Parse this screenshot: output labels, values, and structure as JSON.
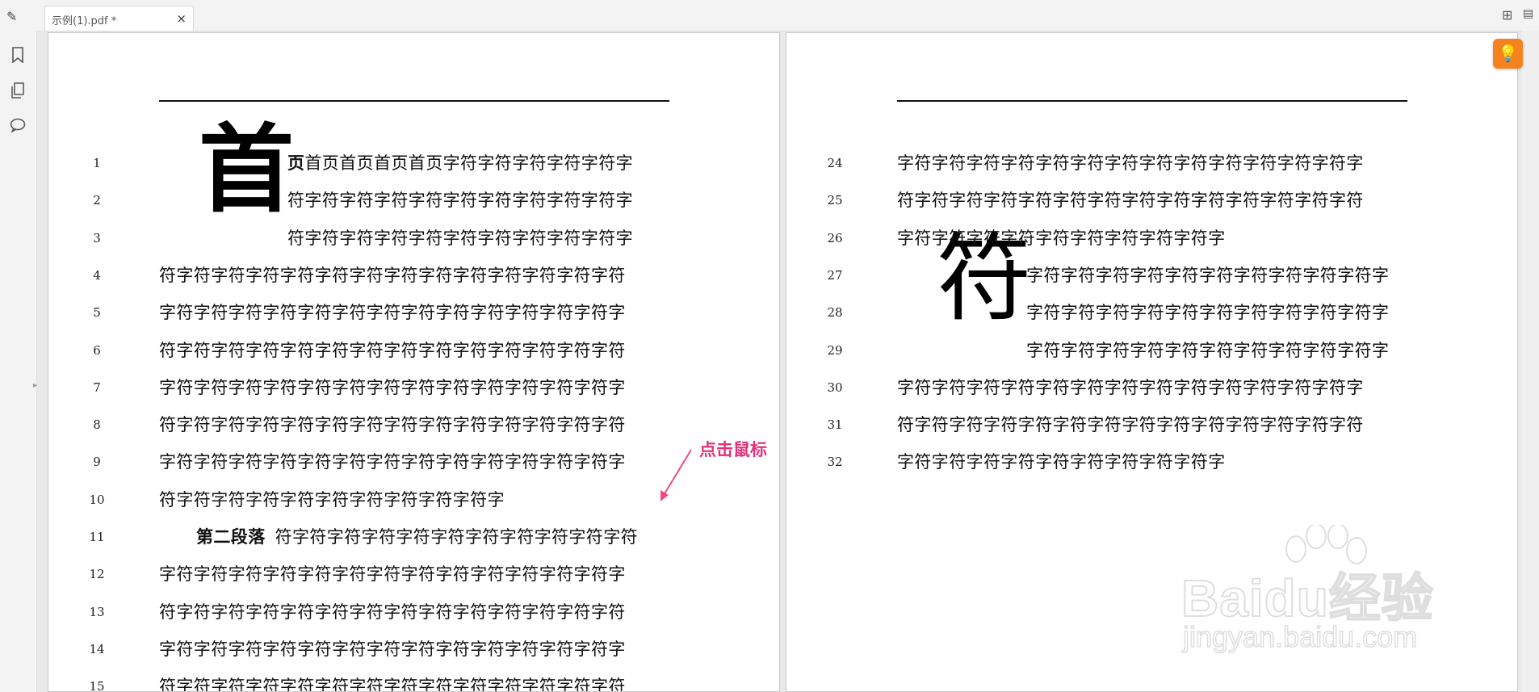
{
  "tab": {
    "title": "示例(1).pdf *",
    "close_glyph": "×"
  },
  "icons": {
    "edit": "pencil-icon",
    "grid": "grid-view-icon",
    "panel": "panel-toggle-icon",
    "bookmark": "bookmark-icon",
    "pages": "pages-icon",
    "comments": "comment-icon",
    "hint": "lightbulb-icon"
  },
  "colors": {
    "accent": "#f5821f",
    "annotation": "#e4317b"
  },
  "annotation": {
    "label": "点击鼠标"
  },
  "left_page": {
    "dropcap": "首",
    "lines": [
      {
        "no": "1",
        "text": "首页首页首页首页字符字符字符字符字符字",
        "lead": "页"
      },
      {
        "no": "2",
        "text": "符字符字符字符字符字符字符字符字符字符字"
      },
      {
        "no": "3",
        "text": "符字符字符字符字符字符字符字符字符字符字"
      },
      {
        "no": "4",
        "text": "符字符字符字符字符字符字符字符字符字符字符字符字符字符"
      },
      {
        "no": "5",
        "text": "字符字符字符字符字符字符字符字符字符字符字符字符字符字"
      },
      {
        "no": "6",
        "text": "符字符字符字符字符字符字符字符字符字符字符字符字符字符"
      },
      {
        "no": "7",
        "text": "字符字符字符字符字符字符字符字符字符字符字符字符字符字"
      },
      {
        "no": "8",
        "text": "符字符字符字符字符字符字符字符字符字符字符字符字符字符"
      },
      {
        "no": "9",
        "text": "字符字符字符字符字符字符字符字符字符字符字符字符字符字"
      },
      {
        "no": "10",
        "text": "符字符字符字符字符字符字符字符字符字符字"
      },
      {
        "no": "11",
        "text": "符字符字符字符字符字符字符字符字符字符字符",
        "lead": "第二段落"
      },
      {
        "no": "12",
        "text": "字符字符字符字符字符字符字符字符字符字符字符字符字符字"
      },
      {
        "no": "13",
        "text": "符字符字符字符字符字符字符字符字符字符字符字符字符字符"
      },
      {
        "no": "14",
        "text": "字符字符字符字符字符字符字符字符字符字符字符字符字符字"
      },
      {
        "no": "15",
        "text": "符字符字符字符字符字符字符字符字符字符字符字符字符字符"
      }
    ]
  },
  "right_page": {
    "dropcap": "符",
    "lines": [
      {
        "no": "24",
        "text": "字符字符字符字符字符字符字符字符字符字符字符字符字符字"
      },
      {
        "no": "25",
        "text": "符字符字符字符字符字符字符字符字符字符字符字符字符字符"
      },
      {
        "no": "26",
        "text": "字符字符字符字符字符字符字符字符字符字"
      },
      {
        "no": "27",
        "text": "字符字符字符字符字符字符字符字符字符字符字"
      },
      {
        "no": "28",
        "text": "字符字符字符字符字符字符字符字符字符字符字"
      },
      {
        "no": "29",
        "text": "字符字符字符字符字符字符字符字符字符字符字"
      },
      {
        "no": "30",
        "text": "字符字符字符字符字符字符字符字符字符字符字符字符字符字"
      },
      {
        "no": "31",
        "text": "符字符字符字符字符字符字符字符字符字符字符字符字符字符"
      },
      {
        "no": "32",
        "text": "字符字符字符字符字符字符字符字符字符字"
      }
    ]
  },
  "watermark": {
    "brand": "Baidu经验",
    "site": "jingyan.baidu.com"
  }
}
